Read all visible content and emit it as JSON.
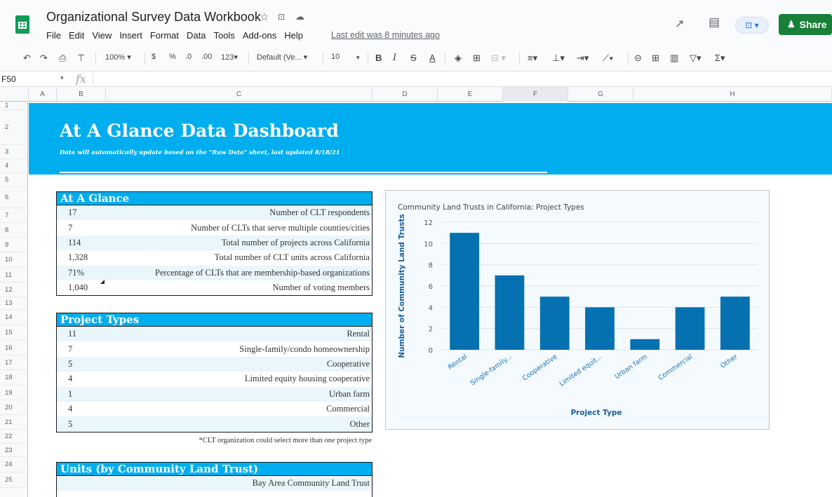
{
  "app": {
    "title": "Organizational Survey Data Workbook",
    "menus": [
      "File",
      "Edit",
      "View",
      "Insert",
      "Format",
      "Data",
      "Tools",
      "Add-ons",
      "Help"
    ],
    "last_edit": "Last edit was 8 minutes ago",
    "share_label": "Share",
    "accent": "#00aeef",
    "share_color": "#188038"
  },
  "toolbar": {
    "zoom": "100%",
    "currency": "$",
    "percent": "%",
    "dec_less": ".0",
    "dec_more": ".00",
    "format": "123",
    "font": "Default (Ve...",
    "size": "10"
  },
  "formula_bar": {
    "cell": "F50",
    "fx": "fx"
  },
  "columns": [
    "A",
    "B",
    "C",
    "D",
    "E",
    "F",
    "G",
    "H"
  ],
  "rows": [
    "1",
    "2",
    "3",
    "4",
    "5",
    "6",
    "7",
    "8",
    "9",
    "10",
    "11",
    "12",
    "13",
    "14",
    "15",
    "16",
    "17",
    "18",
    "19",
    "20",
    "21",
    "22",
    "23",
    "24",
    "25"
  ],
  "banner": {
    "title": "At A Glance Data Dashboard",
    "subtitle": "Data will automatically update based on the \"Raw Data\" sheet, last updated 8/18/21"
  },
  "at_a_glance": {
    "title": "At A Glance",
    "rows": [
      {
        "value": "17",
        "label": "Number of CLT respondents"
      },
      {
        "value": "7",
        "label": "Number of CLTs that serve multiple counties/cities"
      },
      {
        "value": "114",
        "label": "Total number of projects across California"
      },
      {
        "value": "1,328",
        "label": "Total number of CLT units across California"
      },
      {
        "value": "71%",
        "label": "Percentage of CLTs that are membership-based organizations"
      },
      {
        "value": "1,040",
        "label": "Number of voting members"
      }
    ]
  },
  "project_types": {
    "title": "Project Types",
    "rows": [
      {
        "value": "11",
        "label": "Rental"
      },
      {
        "value": "7",
        "label": "Single-family/condo homeownership"
      },
      {
        "value": "5",
        "label": "Cooperative"
      },
      {
        "value": "4",
        "label": "Limited equity housing cooperative"
      },
      {
        "value": "1",
        "label": "Urban farm"
      },
      {
        "value": "4",
        "label": "Commercial"
      },
      {
        "value": "5",
        "label": "Other"
      }
    ],
    "footnote": "*CLT organization could select more than one project type"
  },
  "units": {
    "title": "Units (by Community Land Trust)",
    "rows": [
      {
        "value": "",
        "label": "Bay Area Community Land Trust"
      }
    ]
  },
  "chart_data": {
    "type": "bar",
    "title": "Community Land Trusts in California: Project Types",
    "xlabel": "Project Type",
    "ylabel": "Number of Community Land Trusts",
    "categories": [
      "Rental",
      "Single-family...",
      "Cooperative",
      "Limited equit...",
      "Urban farm",
      "Commercial",
      "Other"
    ],
    "values": [
      11,
      7,
      5,
      4,
      1,
      4,
      5
    ],
    "ylim": [
      0,
      12
    ],
    "yticks": [
      0,
      2,
      4,
      6,
      8,
      10,
      12
    ],
    "grid": true,
    "bar_color": "#0571b0"
  }
}
